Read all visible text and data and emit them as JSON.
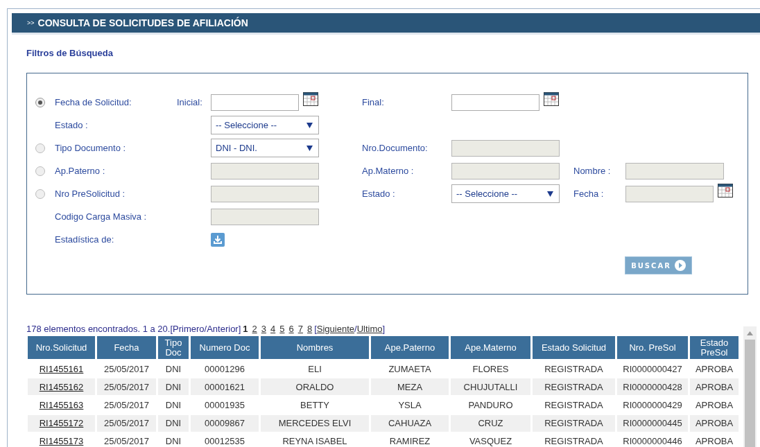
{
  "header": {
    "marker": ">>",
    "title": "CONSULTA DE SOLICITUDES DE AFILIACIÓN"
  },
  "filters": {
    "title": "Filtros de Búsqueda",
    "rows": [
      {
        "radio": {
          "selected": true
        },
        "label": "Fecha de Solicitud:",
        "sub_label": "Inicial:",
        "field": {
          "kind": "date",
          "disabled": false
        },
        "label_2": "Final:",
        "field_2": {
          "kind": "date",
          "disabled": false
        }
      },
      {
        "label": "Estado :",
        "field": {
          "kind": "select",
          "value": "-- Seleccione --"
        }
      },
      {
        "radio": {
          "selected": false
        },
        "label": "Tipo Documento :",
        "field": {
          "kind": "select",
          "value": "DNI - DNI."
        },
        "label_2": "Nro.Documento:",
        "field_2": {
          "kind": "text",
          "disabled": true
        }
      },
      {
        "radio": {
          "selected": false
        },
        "label": "Ap.Paterno :",
        "field": {
          "kind": "text",
          "disabled": true
        },
        "label_2": "Ap.Materno :",
        "field_2": {
          "kind": "text",
          "disabled": true
        },
        "label_3": "Nombre :",
        "field_3": {
          "kind": "text",
          "disabled": true
        }
      },
      {
        "radio": {
          "selected": false
        },
        "label": "Nro PreSolicitud :",
        "field": {
          "kind": "text",
          "disabled": true
        },
        "label_2": "Estado :",
        "field_2": {
          "kind": "select",
          "value": "-- Seleccione --"
        },
        "label_3": "Fecha :",
        "field_3": {
          "kind": "date",
          "disabled": true
        }
      },
      {
        "label": "Codigo Carga Masiva :",
        "field": {
          "kind": "text",
          "disabled": true
        }
      },
      {
        "label": "Estadística de:",
        "field": {
          "kind": "download"
        }
      }
    ],
    "search_button": "BUSCAR"
  },
  "results": {
    "summary": "178 elementos encontrados. 1 a 20.",
    "pager": [
      {
        "kind": "text",
        "label": "[Primero/Anterior]"
      },
      {
        "kind": "page",
        "label": "1",
        "selected": true
      },
      {
        "kind": "page",
        "label": "2",
        "selected": false
      },
      {
        "kind": "page",
        "label": "3",
        "selected": false
      },
      {
        "kind": "page",
        "label": "4",
        "selected": false
      },
      {
        "kind": "page",
        "label": "5",
        "selected": false
      },
      {
        "kind": "page",
        "label": "6",
        "selected": false
      },
      {
        "kind": "page",
        "label": "7",
        "selected": false
      },
      {
        "kind": "page",
        "label": "8",
        "selected": false
      },
      {
        "kind": "text",
        "label": "["
      },
      {
        "kind": "link",
        "label": "Siguiente"
      },
      {
        "kind": "text",
        "label": "/"
      },
      {
        "kind": "link",
        "label": "Ultimo"
      },
      {
        "kind": "text",
        "label": "]"
      }
    ],
    "columns": [
      "Nro.Solicitud",
      "Fecha",
      "Tipo Doc",
      "Numero Doc",
      "Nombres",
      "Ape.Paterno",
      "Ape.Materno",
      "Estado Solicitud",
      "Nro. PreSol",
      "Estado PreSol"
    ],
    "rows": [
      [
        "RI1455161",
        "25/05/2017",
        "DNI",
        "00001296",
        "ELI",
        "ZUMAETA",
        "FLORES",
        "REGISTRADA",
        "RI0000000427",
        "APROBA"
      ],
      [
        "RI1455162",
        "25/05/2017",
        "DNI",
        "00001621",
        "ORALDO",
        "MEZA",
        "CHUJUTALLI",
        "REGISTRADA",
        "RI0000000428",
        "APROBA"
      ],
      [
        "RI1455163",
        "25/05/2017",
        "DNI",
        "00001935",
        "BETTY",
        "YSLA",
        "PANDURO",
        "REGISTRADA",
        "RI0000000429",
        "APROBA"
      ],
      [
        "RI1455172",
        "25/05/2017",
        "DNI",
        "00009867",
        "MERCEDES ELVI",
        "CAHUAZA",
        "CRUZ",
        "REGISTRADA",
        "RI0000000445",
        "APROBA"
      ],
      [
        "RI1455173",
        "25/05/2017",
        "DNI",
        "00012535",
        "REYNA ISABEL",
        "RAMIREZ",
        "VASQUEZ",
        "REGISTRADA",
        "RI0000000446",
        "APROBA"
      ]
    ]
  }
}
